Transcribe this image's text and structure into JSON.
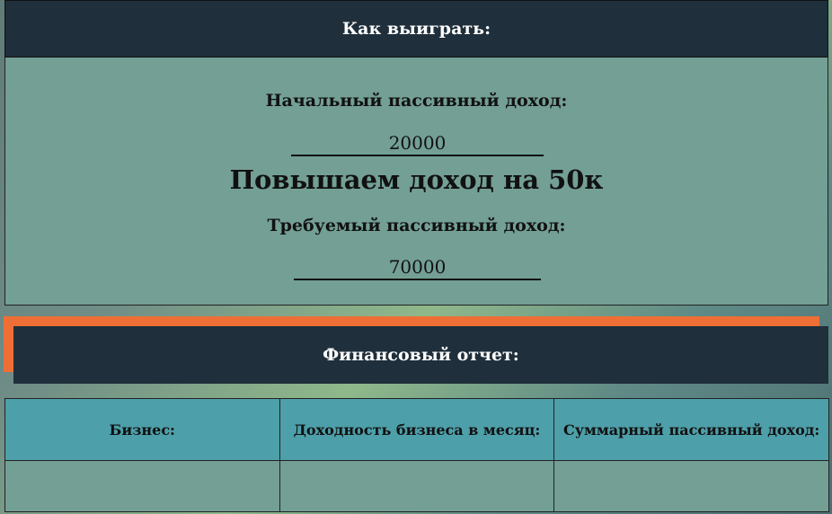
{
  "win": {
    "title": "Как выиграть:",
    "initial_label": "Начальный пассивный доход:",
    "initial_value": "20000",
    "goal_text": "Повышаем доход на 50к",
    "required_label": "Требуемый пассивный доход:",
    "required_value": "70000"
  },
  "report": {
    "title": "Финансовый отчет:",
    "columns": [
      "Бизнес:",
      "Доходность бизнеса в месяц:",
      "Суммарный пассивный доход:"
    ],
    "rows": [
      [
        "",
        "",
        ""
      ]
    ]
  },
  "colors": {
    "header_bg": "#1f2f3b",
    "panel_bg": "#739f95",
    "table_header_bg": "#4d9fa9",
    "accent": "#ee6f36"
  }
}
